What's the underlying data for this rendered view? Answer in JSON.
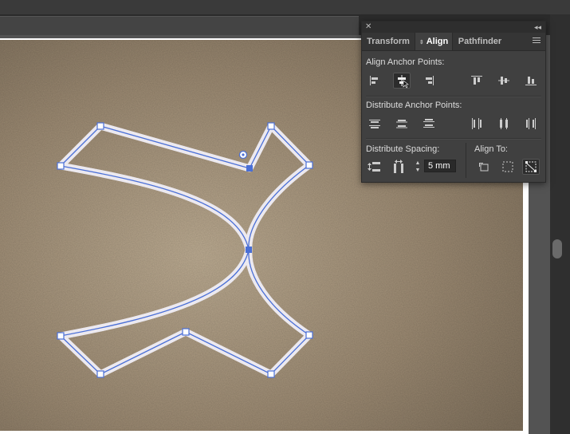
{
  "panel": {
    "tabs": [
      {
        "label": "Transform"
      },
      {
        "label": "Align"
      },
      {
        "label": "Pathfinder"
      }
    ],
    "active_tab": "Align",
    "align_anchor_points_label": "Align Anchor Points:",
    "distribute_anchor_points_label": "Distribute Anchor Points:",
    "distribute_spacing_label": "Distribute Spacing:",
    "align_to_label": "Align To:",
    "spacing_value": "5 mm",
    "buttons": [
      "horizontal-align-left",
      "horizontal-align-center",
      "horizontal-align-right",
      "vertical-align-top",
      "vertical-align-center",
      "vertical-align-bottom",
      "vertical-distribute-top",
      "vertical-distribute-center",
      "vertical-distribute-bottom",
      "horizontal-distribute-left",
      "horizontal-distribute-center",
      "horizontal-distribute-right",
      "vertical-distribute-space",
      "horizontal-distribute-space",
      "align-to-selection",
      "align-to-artboard",
      "align-to-key-anchor"
    ]
  },
  "colors": {
    "panel_bg": "#404040",
    "canvas_bg": "#a8967e",
    "path_stroke": "#e8e6ec",
    "selection": "#4a6fd6"
  }
}
